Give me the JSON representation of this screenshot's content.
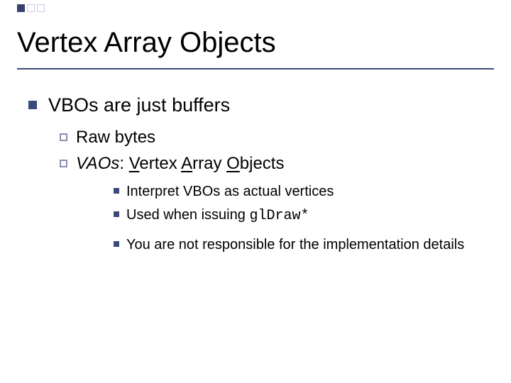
{
  "title": "Vertex Array Objects",
  "l1": {
    "text": "VBOs are just buffers"
  },
  "l2a": {
    "text": "Raw bytes"
  },
  "l2b": {
    "em": "VAOs",
    "colon": ":  ",
    "v_u": "V",
    "v_rest": "ertex ",
    "a_u": "A",
    "a_rest": "rray ",
    "o_u": "O",
    "o_rest": "bjects"
  },
  "l3a": {
    "text": "Interpret VBOs as actual vertices"
  },
  "l3b": {
    "pre": "Used when issuing ",
    "code": "glDraw*"
  },
  "l3c": {
    "text": "You are not responsible for the implementation details"
  }
}
